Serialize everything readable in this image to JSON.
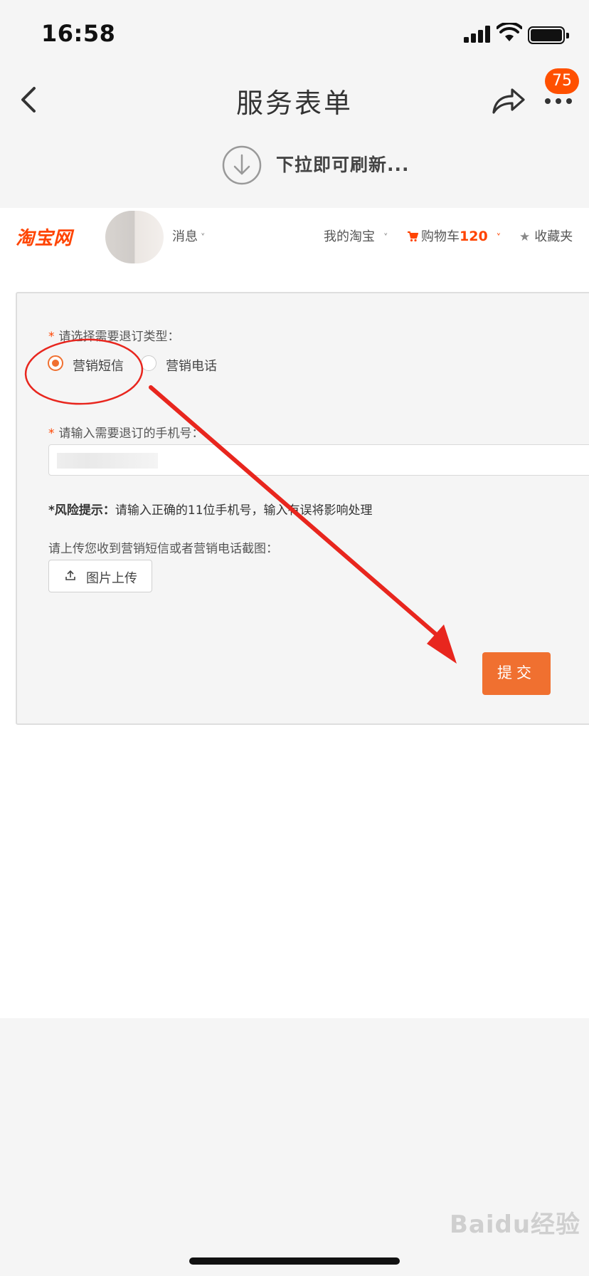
{
  "status_bar": {
    "time": "16:58"
  },
  "nav": {
    "title": "服务表单",
    "badge": "75"
  },
  "refresh": {
    "text": "下拉即可刷新..."
  },
  "site_header": {
    "logo": "淘宝网",
    "messages": "消息",
    "my_taobao": "我的淘宝",
    "cart": "购物车",
    "cart_count": "120",
    "favorites": "收藏夹"
  },
  "form": {
    "type_label": "请选择需要退订类型：",
    "options": [
      {
        "label": "营销短信",
        "checked": true
      },
      {
        "label": "营销电话",
        "checked": false
      }
    ],
    "phone_label": "请输入需要退订的手机号：",
    "risk_title": "*风险提示：",
    "risk_text": "请输入正确的11位手机号，输入有误将影响处理",
    "upload_label": "请上传您收到营销短信或者营销电话截图：",
    "upload_button": "图片上传",
    "submit": "提交"
  },
  "colors": {
    "accent": "#f07030",
    "brand": "#ff4400",
    "annotation": "#e8261e"
  },
  "watermark": "Baidu经验"
}
